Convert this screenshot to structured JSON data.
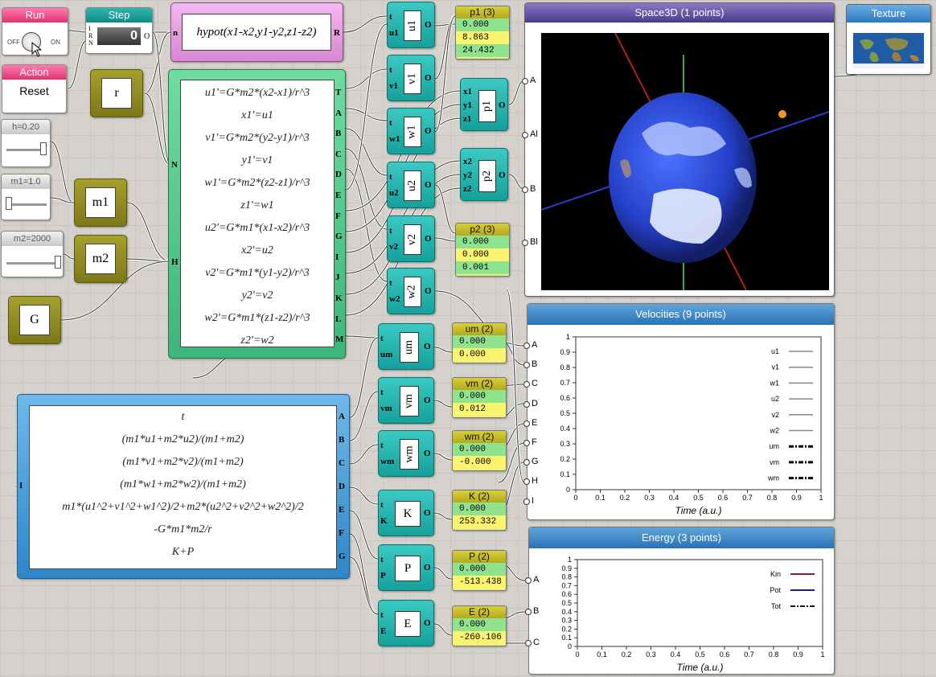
{
  "run": {
    "title": "Run",
    "off": "OFF",
    "on": "ON"
  },
  "step": {
    "title": "Step",
    "value": "0",
    "pins": [
      "I",
      "R",
      "N"
    ],
    "out": "O"
  },
  "action": {
    "title": "Action",
    "button": "Reset"
  },
  "hypot": {
    "expr": "hypot(x1-x2,y1-y2,z1-z2)",
    "in": "n",
    "out": "R"
  },
  "r_block": {
    "label": "r"
  },
  "sliders": [
    {
      "label": "h=0.20",
      "fraction": 0.92
    },
    {
      "label": "m1=1.0",
      "fraction": 0.05
    },
    {
      "label": "m2=2000",
      "fraction": 0.97
    }
  ],
  "m1_block": {
    "label": "m1"
  },
  "m2_block": {
    "label": "m2"
  },
  "g_block": {
    "label": "G"
  },
  "ode": {
    "equations": [
      "u1'=G*m2*(x2-x1)/r^3",
      "x1'=u1",
      "v1'=G*m2*(y2-y1)/r^3",
      "y1'=v1",
      "w1'=G*m2*(z2-z1)/r^3",
      "z1'=w1",
      "u2'=G*m1*(x1-x2)/r^3",
      "x2'=u2",
      "v2'=G*m1*(y1-y2)/r^3",
      "y2'=v2",
      "w2'=G*m1*(z1-z2)/r^3",
      "z2'=w2"
    ],
    "outputs": [
      "T",
      "A",
      "B",
      "C",
      "D",
      "E",
      "F",
      "G",
      "I",
      "J",
      "K",
      "L",
      "M"
    ],
    "inputs": [
      "N",
      "H"
    ]
  },
  "calc": {
    "expressions": [
      "t",
      "(m1*u1+m2*u2)/(m1+m2)",
      "(m1*v1+m2*v2)/(m1+m2)",
      "(m1*w1+m2*w2)/(m1+m2)",
      "m1*(u1^2+v1^2+w1^2)/2+m2*(u2^2+v2^2+w2^2)/2",
      "-G*m1*m2/r",
      "K+P"
    ],
    "outputs": [
      "A",
      "B",
      "C",
      "D",
      "E",
      "F",
      "G"
    ],
    "input": "I"
  },
  "tblocks": [
    {
      "name": "u1",
      "pin": "u1"
    },
    {
      "name": "v1",
      "pin": "v1"
    },
    {
      "name": "w1",
      "pin": "w1"
    },
    {
      "name": "u2",
      "pin": "u2"
    },
    {
      "name": "v2",
      "pin": "v2"
    },
    {
      "name": "w2",
      "pin": "w2"
    },
    {
      "name": "um",
      "pin": "um"
    },
    {
      "name": "vm",
      "pin": "vm"
    },
    {
      "name": "wm",
      "pin": "wm"
    },
    {
      "name": "K",
      "pin": "K"
    },
    {
      "name": "P",
      "pin": "P"
    },
    {
      "name": "E",
      "pin": "E"
    }
  ],
  "p1_block": {
    "label": "p1",
    "pins": [
      "x1",
      "y1",
      "z1"
    ]
  },
  "p2_block": {
    "label": "p2",
    "pins": [
      "x2",
      "y2",
      "z2"
    ]
  },
  "displays": [
    {
      "title": "p1 (3)",
      "rows": [
        "0.000",
        "8.863",
        "24.432"
      ]
    },
    {
      "title": "p2 (3)",
      "rows": [
        "0.000",
        "0.000",
        "0.001"
      ]
    },
    {
      "title": "um (2)",
      "rows": [
        "0.000",
        "0.000"
      ]
    },
    {
      "title": "vm (2)",
      "rows": [
        "0.000",
        "0.012"
      ]
    },
    {
      "title": "wm (2)",
      "rows": [
        "0.000",
        "-0.000"
      ]
    },
    {
      "title": "K (2)",
      "rows": [
        "0.000",
        "253.332"
      ]
    },
    {
      "title": "P (2)",
      "rows": [
        "0.000",
        "-513.438"
      ]
    },
    {
      "title": "E (2)",
      "rows": [
        "0.000",
        "-260.106"
      ]
    }
  ],
  "space3d": {
    "title": "Space3D (1 points)",
    "ports": [
      "A",
      "Al",
      "B",
      "Bl"
    ]
  },
  "texture": {
    "title": "Texture"
  },
  "velocities": {
    "title": "Velocities (9 points)",
    "ports": [
      "A",
      "B",
      "C",
      "D",
      "E",
      "F",
      "G",
      "H",
      "I"
    ],
    "xlabel": "Time (a.u.)",
    "ticks": [
      "0",
      "0.1",
      "0.2",
      "0.3",
      "0.4",
      "0.5",
      "0.6",
      "0.7",
      "0.8",
      "0.9",
      "1"
    ],
    "legend": [
      "u1",
      "v1",
      "w1",
      "u2",
      "v2",
      "w2",
      "um",
      "vm",
      "wm"
    ]
  },
  "energy": {
    "title": "Energy (3 points)",
    "ports": [
      "A",
      "B",
      "C"
    ],
    "xlabel": "Time (a.u.)",
    "ticks": [
      "0",
      "0.1",
      "0.2",
      "0.3",
      "0.4",
      "0.5",
      "0.6",
      "0.7",
      "0.8",
      "0.9",
      "1"
    ],
    "legend": [
      "Kin",
      "Pot",
      "Tot"
    ],
    "colors": {
      "Kin": "#8b1a3a",
      "Pot": "#1a1a8b",
      "Tot": "#111111"
    }
  }
}
